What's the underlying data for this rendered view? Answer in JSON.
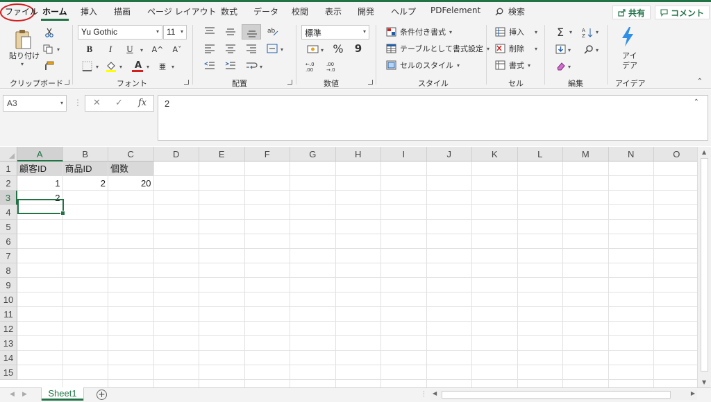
{
  "tabs": {
    "file": "ファイル",
    "home": "ホーム",
    "insert": "挿入",
    "draw": "描画",
    "page_layout": "ページ レイアウト",
    "formulas": "数式",
    "data": "データ",
    "review": "校閲",
    "view": "表示",
    "developer": "開発",
    "help": "ヘルプ",
    "pdfelement": "PDFelement",
    "search": "検索",
    "share": "共有",
    "comment": "コメント"
  },
  "ribbon": {
    "clipboard": {
      "label": "クリップボード",
      "paste": "貼り付け"
    },
    "font": {
      "label": "フォント",
      "font_name": "Yu Gothic",
      "font_size": "11",
      "bold": "B",
      "italic": "I",
      "underline": "U",
      "grow": "A^",
      "shrink": "Aˇ",
      "font_color": "A",
      "phonetic": "亜"
    },
    "alignment": {
      "label": "配置"
    },
    "number": {
      "label": "数値",
      "format": "標準",
      "percent": "%",
      "comma": "9",
      "inc_decimal": "←.0 .00",
      "dec_decimal": ".00 →.0"
    },
    "styles": {
      "label": "スタイル",
      "conditional": "条件付き書式",
      "table": "テーブルとして書式設定",
      "cell_styles": "セルのスタイル"
    },
    "cells": {
      "label": "セル",
      "insert": "挿入",
      "delete": "削除",
      "format": "書式"
    },
    "editing": {
      "label": "編集",
      "sum": "Σ"
    },
    "ideas": {
      "label": "アイデア",
      "button_line1": "アイ",
      "button_line2": "デア"
    }
  },
  "formula_bar": {
    "name_box": "A3",
    "fx": "fx",
    "cancel": "✕",
    "enter": "✓",
    "content": "2"
  },
  "grid": {
    "columns": [
      "A",
      "B",
      "C",
      "D",
      "E",
      "F",
      "G",
      "H",
      "I",
      "J",
      "K",
      "L",
      "M",
      "N",
      "O"
    ],
    "rows": [
      "1",
      "2",
      "3",
      "4",
      "5",
      "6",
      "7",
      "8",
      "9",
      "10",
      "11",
      "12",
      "13",
      "14",
      "15"
    ],
    "cells": {
      "A1": "顧客ID",
      "B1": "商品ID",
      "C1": "個数",
      "A2": "1",
      "B2": "2",
      "C2": "20",
      "A3": "2"
    },
    "selected_cell": "A3"
  },
  "sheets": {
    "active": "Sheet1",
    "add": "+"
  },
  "colors": {
    "accent": "#217346",
    "file_highlight": "#d21f1f"
  }
}
